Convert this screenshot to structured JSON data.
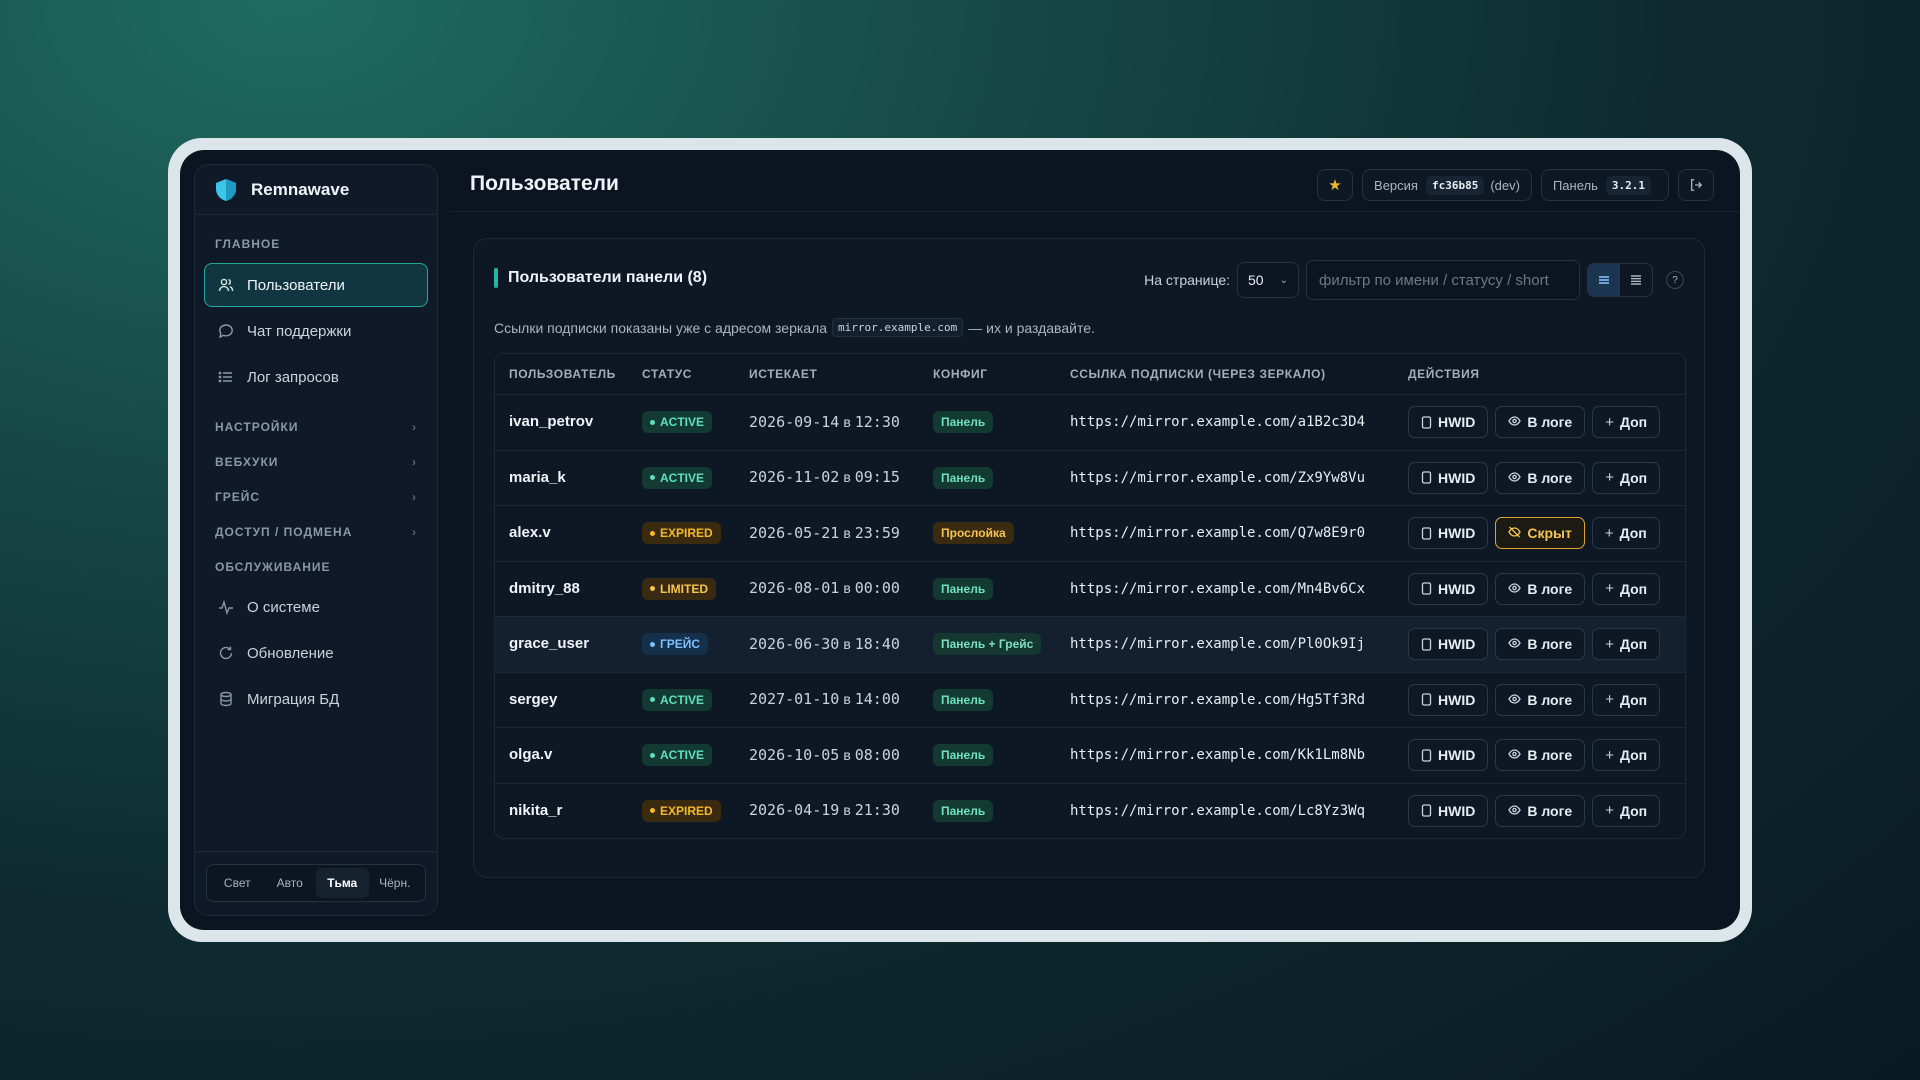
{
  "app": {
    "name": "Remnawave",
    "page_title": "Пользователи"
  },
  "sidebar": {
    "section_main": "ГЛАВНОЕ",
    "items_main": [
      {
        "label": "Пользователи",
        "icon": "users-icon",
        "active": true
      },
      {
        "label": "Чат поддержки",
        "icon": "chat-icon"
      },
      {
        "label": "Лог запросов",
        "icon": "list-icon"
      }
    ],
    "collapsible_sections": [
      "НАСТРОЙКИ",
      "ВЕБХУКИ",
      "ГРЕЙС",
      "ДОСТУП / ПОДМЕНА"
    ],
    "section_service": "ОБСЛУЖИВАНИЕ",
    "items_service": [
      {
        "label": "О системе",
        "icon": "activity-icon"
      },
      {
        "label": "Обновление",
        "icon": "refresh-icon"
      },
      {
        "label": "Миграция БД",
        "icon": "database-icon"
      }
    ],
    "themes": [
      "Свет",
      "Авто",
      "Тьма",
      "Чёрн."
    ],
    "active_theme": "Тьма"
  },
  "topbar": {
    "version_label": "Версия",
    "version_hash": "fc36b85",
    "version_tag": "(dev)",
    "panel_label": "Панель",
    "panel_version": "3.2.1"
  },
  "card": {
    "title": "Пользователи панели (8)",
    "per_page_label": "На странице:",
    "per_page_value": "50",
    "filter_placeholder": "фильтр по имени / статусу / short",
    "desc_before": "Ссылки подписки показаны уже с адресом зеркала",
    "desc_domain": "mirror.example.com",
    "desc_after": "— их и раздавайте.",
    "help": "?"
  },
  "table": {
    "headers": [
      "ПОЛЬЗОВАТЕЛЬ",
      "СТАТУС",
      "ИСТЕКАЕТ",
      "КОНФИГ",
      "ССЫЛКА ПОДПИСКИ (ЧЕРЕЗ ЗЕРКАЛО)",
      "ДЕЙСТВИЯ"
    ],
    "date_sep": "в",
    "rows": [
      {
        "user": "ivan_petrov",
        "status": "ACTIVE",
        "status_kind": "active",
        "date": "2026-09-14",
        "time": "12:30",
        "config": "Панель",
        "config_kind": "panel",
        "link": "https://mirror.example.com/a1B2c3D4",
        "btn_hwid": "HWID",
        "btn_log": "В логе",
        "btn_log_kind": "normal",
        "btn_more": "Доп"
      },
      {
        "user": "maria_k",
        "status": "ACTIVE",
        "status_kind": "active",
        "date": "2026-11-02",
        "time": "09:15",
        "config": "Панель",
        "config_kind": "panel",
        "link": "https://mirror.example.com/Zx9Yw8Vu",
        "btn_hwid": "HWID",
        "btn_log": "В логе",
        "btn_log_kind": "normal",
        "btn_more": "Доп"
      },
      {
        "user": "alex.v",
        "status": "EXPIRED",
        "status_kind": "expired",
        "date": "2026-05-21",
        "time": "23:59",
        "config": "Прослойка",
        "config_kind": "prosl",
        "link": "https://mirror.example.com/Q7w8E9r0",
        "btn_hwid": "HWID",
        "btn_log": "Скрыт",
        "btn_log_kind": "warn",
        "btn_more": "Доп"
      },
      {
        "user": "dmitry_88",
        "status": "LIMITED",
        "status_kind": "limited",
        "date": "2026-08-01",
        "time": "00:00",
        "config": "Панель",
        "config_kind": "panel",
        "link": "https://mirror.example.com/Mn4Bv6Cx",
        "btn_hwid": "HWID",
        "btn_log": "В логе",
        "btn_log_kind": "normal",
        "btn_more": "Доп"
      },
      {
        "user": "grace_user",
        "status": "ГРЕЙС",
        "status_kind": "grace",
        "date": "2026-06-30",
        "time": "18:40",
        "config": "Панель + Грейс",
        "config_kind": "grace",
        "link": "https://mirror.example.com/Pl0Ok9Ij",
        "btn_hwid": "HWID",
        "btn_log": "В логе",
        "btn_log_kind": "normal",
        "btn_more": "Доп",
        "highlight": true
      },
      {
        "user": "sergey",
        "status": "ACTIVE",
        "status_kind": "active",
        "date": "2027-01-10",
        "time": "14:00",
        "config": "Панель",
        "config_kind": "panel",
        "link": "https://mirror.example.com/Hg5Tf3Rd",
        "btn_hwid": "HWID",
        "btn_log": "В логе",
        "btn_log_kind": "normal",
        "btn_more": "Доп"
      },
      {
        "user": "olga.v",
        "status": "ACTIVE",
        "status_kind": "active",
        "date": "2026-10-05",
        "time": "08:00",
        "config": "Панель",
        "config_kind": "panel",
        "link": "https://mirror.example.com/Kk1Lm8Nb",
        "btn_hwid": "HWID",
        "btn_log": "В логе",
        "btn_log_kind": "normal",
        "btn_more": "Доп"
      },
      {
        "user": "nikita_r",
        "status": "EXPIRED",
        "status_kind": "expired",
        "date": "2026-04-19",
        "time": "21:30",
        "config": "Панель",
        "config_kind": "panel",
        "link": "https://mirror.example.com/Lc8Yz3Wq",
        "btn_hwid": "HWID",
        "btn_log": "В логе",
        "btn_log_kind": "normal",
        "btn_more": "Доп"
      }
    ]
  },
  "colors": {
    "accent": "#22b8a6",
    "active": "#5fe0b8",
    "expired": "#f5b82a",
    "grace": "#7cc0ff",
    "star": "#f5b82a"
  }
}
